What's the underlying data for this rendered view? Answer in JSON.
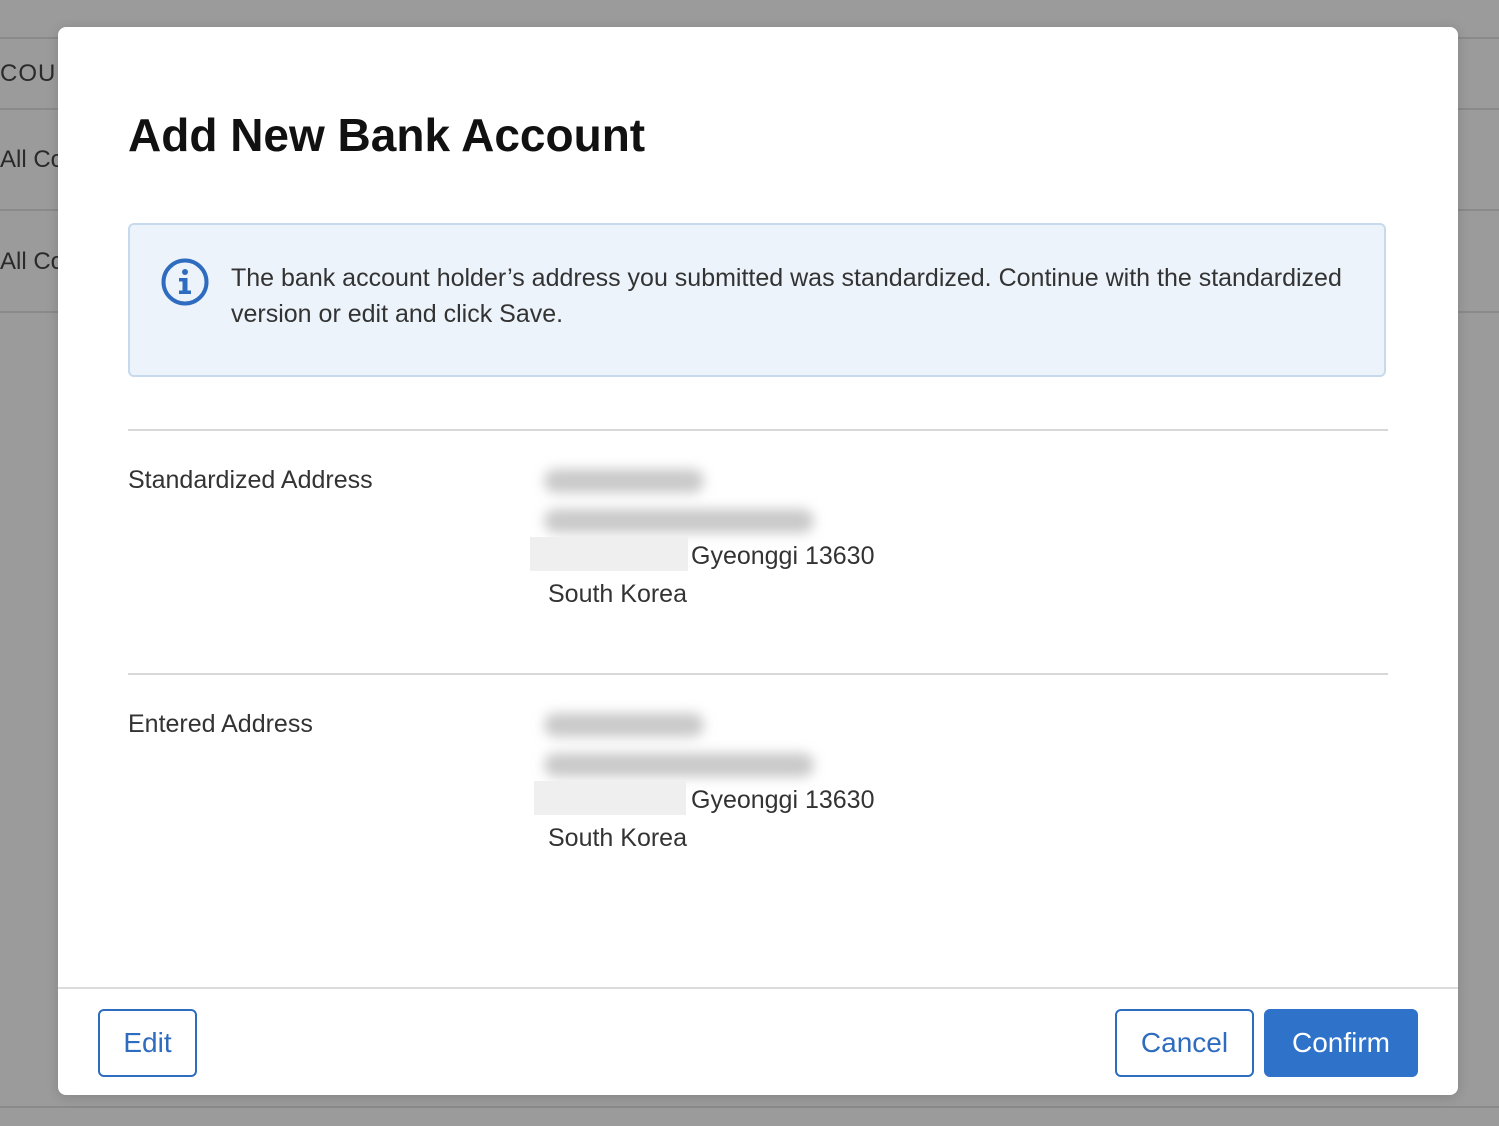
{
  "background": {
    "header_text": "COUN",
    "rows": [
      "All Co",
      "All Co"
    ]
  },
  "modal": {
    "title": "Add New Bank Account",
    "info": {
      "icon": "info-circle-icon",
      "message": "The bank account holder’s address you submitted was standardized. Continue with the standardized version or edit and click Save."
    },
    "standardized": {
      "label": "Standardized Address",
      "region_line": "Gyeonggi 13630",
      "country": "South Korea"
    },
    "entered": {
      "label": "Entered Address",
      "region_line": "Gyeonggi 13630",
      "country": "South Korea"
    },
    "buttons": {
      "edit": "Edit",
      "cancel": "Cancel",
      "confirm": "Confirm"
    }
  },
  "colors": {
    "accent": "#2e72c9",
    "info_background": "#ecf3fb",
    "overlay": "#9b9b9b"
  }
}
